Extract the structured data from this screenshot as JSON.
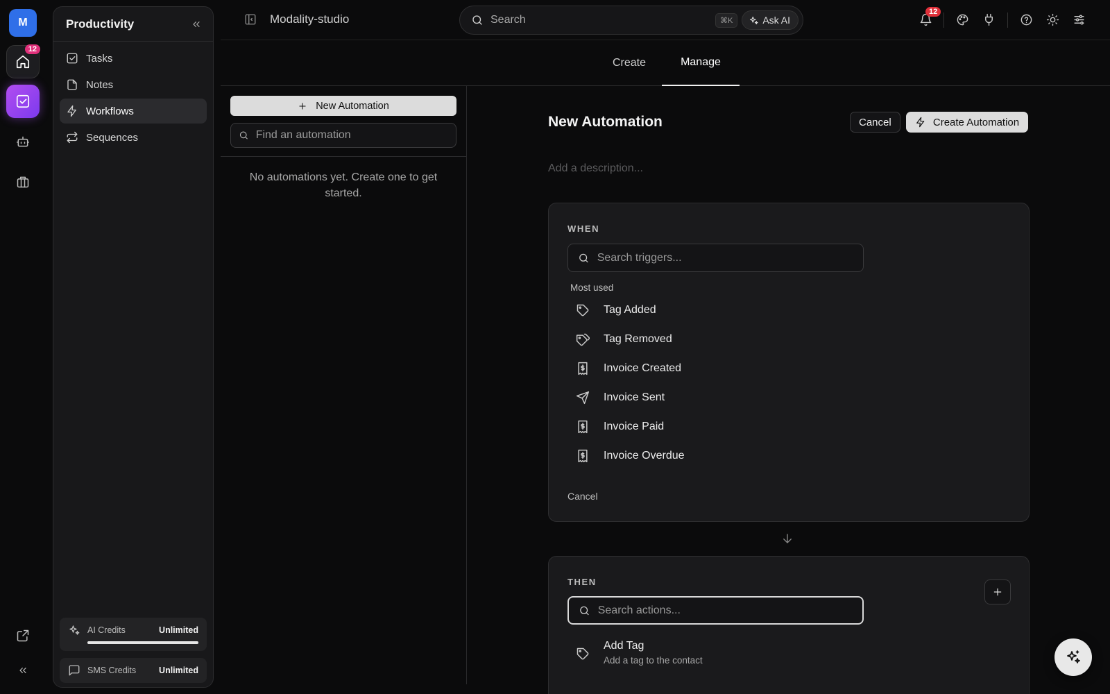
{
  "rail": {
    "avatar_letter": "M",
    "home_badge": "12",
    "items": [
      "home-icon",
      "tasks-icon",
      "bot-icon",
      "briefcase-icon"
    ],
    "bottom": [
      "external-link-icon",
      "collapse-icon"
    ]
  },
  "panel": {
    "title": "Productivity",
    "nav": [
      {
        "label": "Tasks",
        "icon": "checkbox-icon",
        "active": false
      },
      {
        "label": "Notes",
        "icon": "file-icon",
        "active": false
      },
      {
        "label": "Workflows",
        "icon": "zap-icon",
        "active": true
      },
      {
        "label": "Sequences",
        "icon": "repeat-icon",
        "active": false
      }
    ],
    "credits": {
      "ai_label": "AI Credits",
      "ai_value": "Unlimited",
      "ai_usage_fraction": 1.0,
      "sms_label": "SMS Credits",
      "sms_value": "Unlimited"
    }
  },
  "topbar": {
    "workspace": "Modality-studio",
    "search_label": "Search",
    "shortcut": "⌘K",
    "ask_ai": "Ask AI",
    "notification_count": "12",
    "icons": [
      "bell-icon",
      "palette-icon",
      "plug-icon",
      "help-icon",
      "sun-icon",
      "sliders-icon"
    ]
  },
  "tabs": {
    "create": "Create",
    "manage": "Manage",
    "active": "Manage"
  },
  "list": {
    "new_button": "New Automation",
    "find_placeholder": "Find an automation",
    "empty_message": "No automations yet. Create one to get started."
  },
  "editor": {
    "title": "New Automation",
    "cancel": "Cancel",
    "create": "Create Automation",
    "description_placeholder": "Add a description...",
    "when": {
      "label": "WHEN",
      "search_placeholder": "Search triggers...",
      "group_label": "Most used",
      "triggers": [
        {
          "label": "Tag Added",
          "icon": "tag-icon"
        },
        {
          "label": "Tag Removed",
          "icon": "tags-icon"
        },
        {
          "label": "Invoice Created",
          "icon": "receipt-icon"
        },
        {
          "label": "Invoice Sent",
          "icon": "send-icon"
        },
        {
          "label": "Invoice Paid",
          "icon": "receipt-icon"
        },
        {
          "label": "Invoice Overdue",
          "icon": "receipt-icon"
        }
      ],
      "cancel": "Cancel"
    },
    "then": {
      "label": "THEN",
      "search_placeholder": "Search actions...",
      "actions": [
        {
          "label": "Add Tag",
          "description": "Add a tag to the contact",
          "icon": "tag-icon"
        }
      ]
    }
  }
}
